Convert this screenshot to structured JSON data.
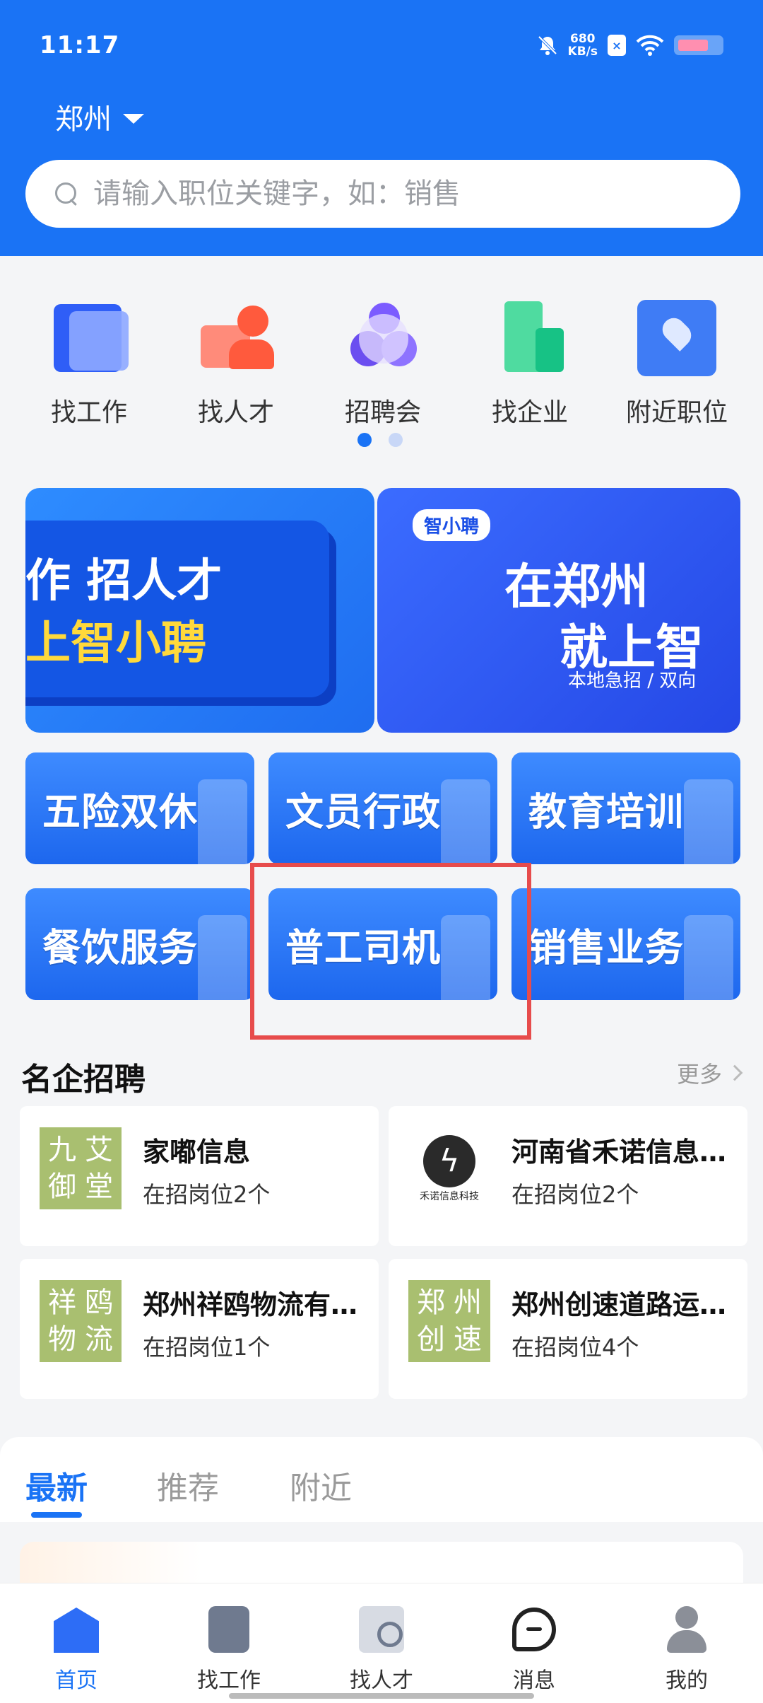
{
  "status_bar": {
    "time": "11:17",
    "speed_value": "680",
    "speed_unit": "KB/s",
    "sim_label": "×"
  },
  "header": {
    "city": "郑州",
    "search_placeholder": "请输入职位关键字，如：销售"
  },
  "quick_entries": [
    {
      "label": "找工作",
      "icon": "folder-edit-icon"
    },
    {
      "label": "找人才",
      "icon": "person-check-icon"
    },
    {
      "label": "招聘会",
      "icon": "circles-icon"
    },
    {
      "label": "找企业",
      "icon": "building-icon"
    },
    {
      "label": "附近职位",
      "icon": "location-pin-icon"
    }
  ],
  "banners": {
    "left": {
      "line1": "作 招人才",
      "line2": "上智小聘"
    },
    "right": {
      "logo": "智小聘",
      "line1": "在郑州",
      "line2": "就上智",
      "line3": "本地急招 / 双向"
    }
  },
  "categories": [
    {
      "label": "五险双休"
    },
    {
      "label": "文员行政"
    },
    {
      "label": "教育培训"
    },
    {
      "label": "餐饮服务"
    },
    {
      "label": "普工司机"
    },
    {
      "label": "销售业务"
    }
  ],
  "famous": {
    "title": "名企招聘",
    "more": "更多",
    "companies": [
      {
        "logo_chars": [
          "九",
          "艾",
          "御",
          "堂"
        ],
        "name": "家嘟信息",
        "posts": "在招岗位2个"
      },
      {
        "logo_symbol": "ϟ",
        "logo_caption": "禾诺信息科技",
        "name": "河南省禾诺信息…",
        "posts": "在招岗位2个"
      },
      {
        "logo_chars": [
          "祥",
          "鸥",
          "物",
          "流"
        ],
        "name": "郑州祥鸥物流有…",
        "posts": "在招岗位1个"
      },
      {
        "logo_chars": [
          "郑",
          "州",
          "创",
          "速"
        ],
        "name": "郑州创速道路运…",
        "posts": "在招岗位4个"
      }
    ]
  },
  "feed_tabs": {
    "latest": "最新",
    "recommend": "推荐",
    "nearby": "附近"
  },
  "bottom_nav": {
    "home": "首页",
    "jobs": "找工作",
    "talent": "找人才",
    "messages": "消息",
    "me": "我的"
  },
  "colors": {
    "brand": "#1a73f5",
    "highlight_box": "#e74c4c",
    "logo_green": "#a9bf70"
  }
}
